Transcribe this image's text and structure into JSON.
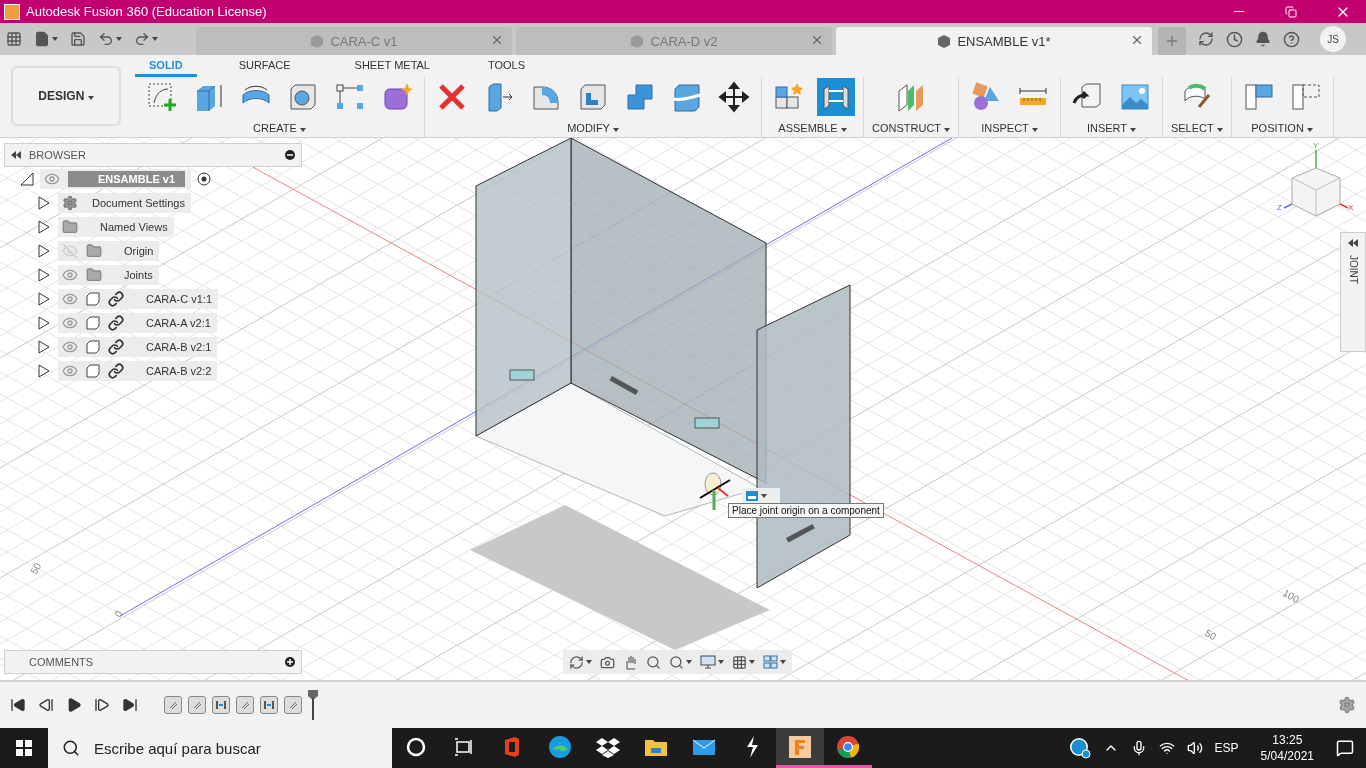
{
  "window": {
    "title": "Autodesk Fusion 360 (Education License)"
  },
  "doc_tabs": [
    {
      "label": "CARA-C v1",
      "selected": false
    },
    {
      "label": "CARA-D v2",
      "selected": false
    },
    {
      "label": "ENSAMBLE v1*",
      "selected": true
    }
  ],
  "user": {
    "initials": "JS"
  },
  "workspace": {
    "label": "DESIGN"
  },
  "toolbar_tabs": [
    {
      "label": "SOLID",
      "selected": true
    },
    {
      "label": "SURFACE",
      "selected": false
    },
    {
      "label": "SHEET METAL",
      "selected": false
    },
    {
      "label": "TOOLS",
      "selected": false
    }
  ],
  "tool_groups": [
    {
      "label": "CREATE",
      "tools": [
        {
          "kind": "sketch",
          "selected": false
        },
        {
          "kind": "extrude",
          "selected": false
        },
        {
          "kind": "revolve",
          "selected": false
        },
        {
          "kind": "hole",
          "selected": false
        },
        {
          "kind": "pattern",
          "selected": false
        },
        {
          "kind": "form",
          "selected": false
        }
      ]
    },
    {
      "label": "MODIFY",
      "tools": [
        {
          "kind": "delete",
          "selected": false
        },
        {
          "kind": "presspull",
          "selected": false
        },
        {
          "kind": "fillet",
          "selected": false
        },
        {
          "kind": "shell",
          "selected": false
        },
        {
          "kind": "combine",
          "selected": false
        },
        {
          "kind": "split",
          "selected": false
        },
        {
          "kind": "move",
          "selected": false
        }
      ]
    },
    {
      "label": "ASSEMBLE",
      "tools": [
        {
          "kind": "component",
          "selected": false
        },
        {
          "kind": "joint",
          "selected": true
        }
      ]
    },
    {
      "label": "CONSTRUCT",
      "tools": [
        {
          "kind": "plane",
          "selected": false
        }
      ]
    },
    {
      "label": "INSPECT",
      "tools": [
        {
          "kind": "interference",
          "selected": false
        },
        {
          "kind": "measure",
          "selected": false
        }
      ]
    },
    {
      "label": "INSERT",
      "tools": [
        {
          "kind": "insert",
          "selected": false
        },
        {
          "kind": "image",
          "selected": false
        }
      ]
    },
    {
      "label": "SELECT",
      "tools": [
        {
          "kind": "select",
          "selected": false
        }
      ]
    },
    {
      "label": "POSITION",
      "tools": [
        {
          "kind": "capture",
          "selected": false
        },
        {
          "kind": "revert",
          "selected": false
        }
      ]
    }
  ],
  "browser": {
    "title": "BROWSER",
    "root": {
      "label": "ENSAMBLE v1",
      "expanded": true,
      "hidden": false,
      "children": [
        {
          "label": "Document Settings",
          "kind": "settings",
          "expanded": false
        },
        {
          "label": "Named Views",
          "kind": "folder",
          "expanded": false
        },
        {
          "label": "Origin",
          "kind": "folder",
          "hidden": true,
          "expanded": false
        },
        {
          "label": "Joints",
          "kind": "folder",
          "hidden": false,
          "expanded": false
        },
        {
          "label": "CARA-C v1:1",
          "kind": "linked",
          "hidden": false,
          "expanded": false
        },
        {
          "label": "CARA-A v2:1",
          "kind": "linked",
          "hidden": false,
          "expanded": false
        },
        {
          "label": "CARA-B v2:1",
          "kind": "linked",
          "hidden": false,
          "expanded": false
        },
        {
          "label": "CARA-B v2:2",
          "kind": "linked",
          "hidden": false,
          "expanded": false
        }
      ]
    }
  },
  "comments": {
    "title": "COMMENTS"
  },
  "side_panel": {
    "title": "JOINT"
  },
  "tooltip": "Place joint origin on a component",
  "view_cube": {
    "axes": [
      "Y",
      "Z",
      "X"
    ]
  },
  "grid_labels": [
    "50",
    "0",
    "100",
    "50"
  ],
  "timeline": {
    "items": [
      {
        "kind": "component"
      },
      {
        "kind": "component"
      },
      {
        "kind": "joint"
      },
      {
        "kind": "component"
      },
      {
        "kind": "joint"
      },
      {
        "kind": "component"
      }
    ]
  },
  "taskbar": {
    "search": {
      "placeholder": "Escribe aquí para buscar"
    },
    "apps": [
      {
        "kind": "cortana",
        "selected": false,
        "running": false
      },
      {
        "kind": "taskview",
        "selected": false,
        "running": false
      },
      {
        "kind": "office",
        "selected": false,
        "running": false
      },
      {
        "kind": "edge",
        "selected": false,
        "running": false
      },
      {
        "kind": "dropbox",
        "selected": false,
        "running": false
      },
      {
        "kind": "explorer",
        "selected": false,
        "running": false
      },
      {
        "kind": "mail",
        "selected": false,
        "running": false
      },
      {
        "kind": "bolt",
        "selected": false,
        "running": false
      },
      {
        "kind": "fusion",
        "selected": true,
        "running": true
      },
      {
        "kind": "chrome",
        "selected": false,
        "running": true
      }
    ],
    "language": "ESP",
    "time": "13:25",
    "date": "5/04/2021"
  }
}
